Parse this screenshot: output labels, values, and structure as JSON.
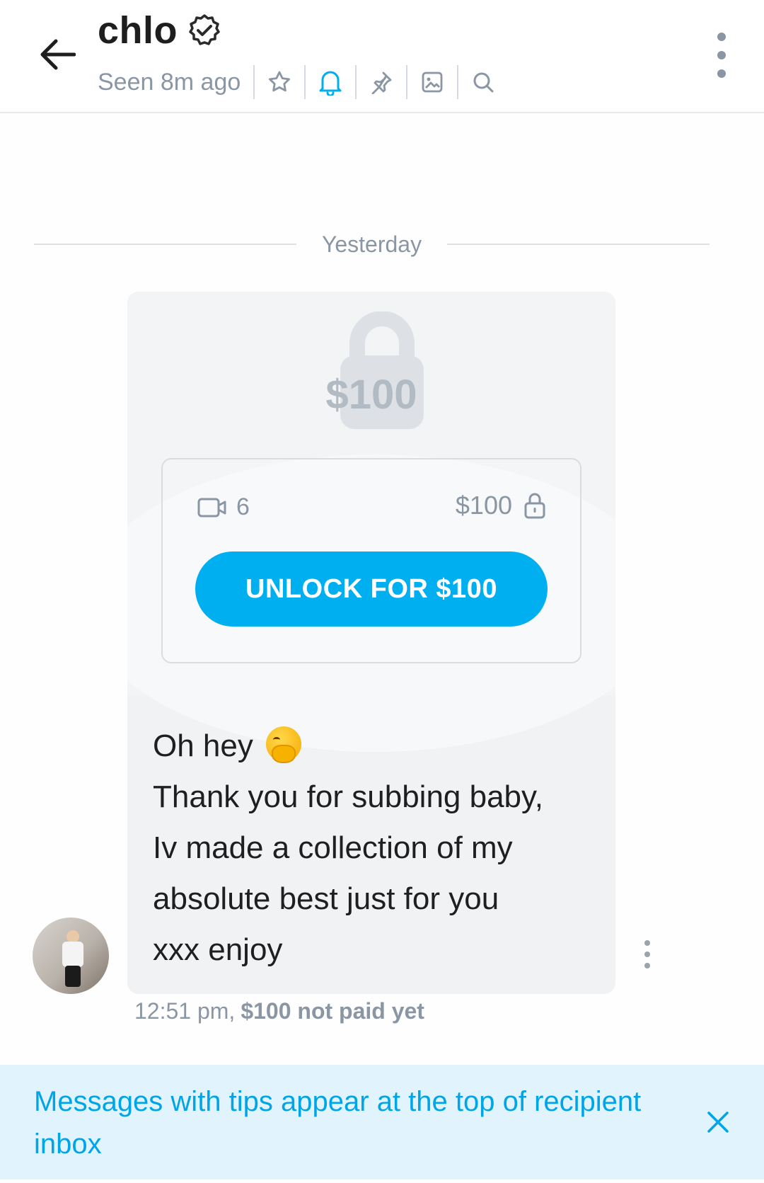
{
  "header": {
    "title": "chlo",
    "verified_icon": "verified-badge-icon",
    "status": "Seen 8m ago",
    "tools": [
      "star-icon",
      "bell-icon",
      "pin-icon",
      "gallery-icon",
      "search-icon"
    ],
    "colors": {
      "bell_active": "#00aff0",
      "tool_default": "#8a96a3"
    }
  },
  "conversation": {
    "date_label": "Yesterday",
    "message": {
      "locked_preview_price": "$100",
      "media_count": "6",
      "media_type_icon": "video-icon",
      "price": "$100",
      "unlock_label": "UNLOCK FOR $100",
      "text_lines": [
        "Oh hey",
        "Thank you for subbing baby,",
        "Iv made a collection of my",
        "absolute best just for you",
        "xxx enjoy"
      ],
      "emoji": "face-with-hand-over-mouth",
      "time": "12:51 pm,",
      "payment_status": "$100 not paid yet"
    }
  },
  "banner": {
    "text": "Messages with tips appear at the top of recipient inbox",
    "close_icon": "close-icon"
  },
  "accent_color": "#00aff0"
}
